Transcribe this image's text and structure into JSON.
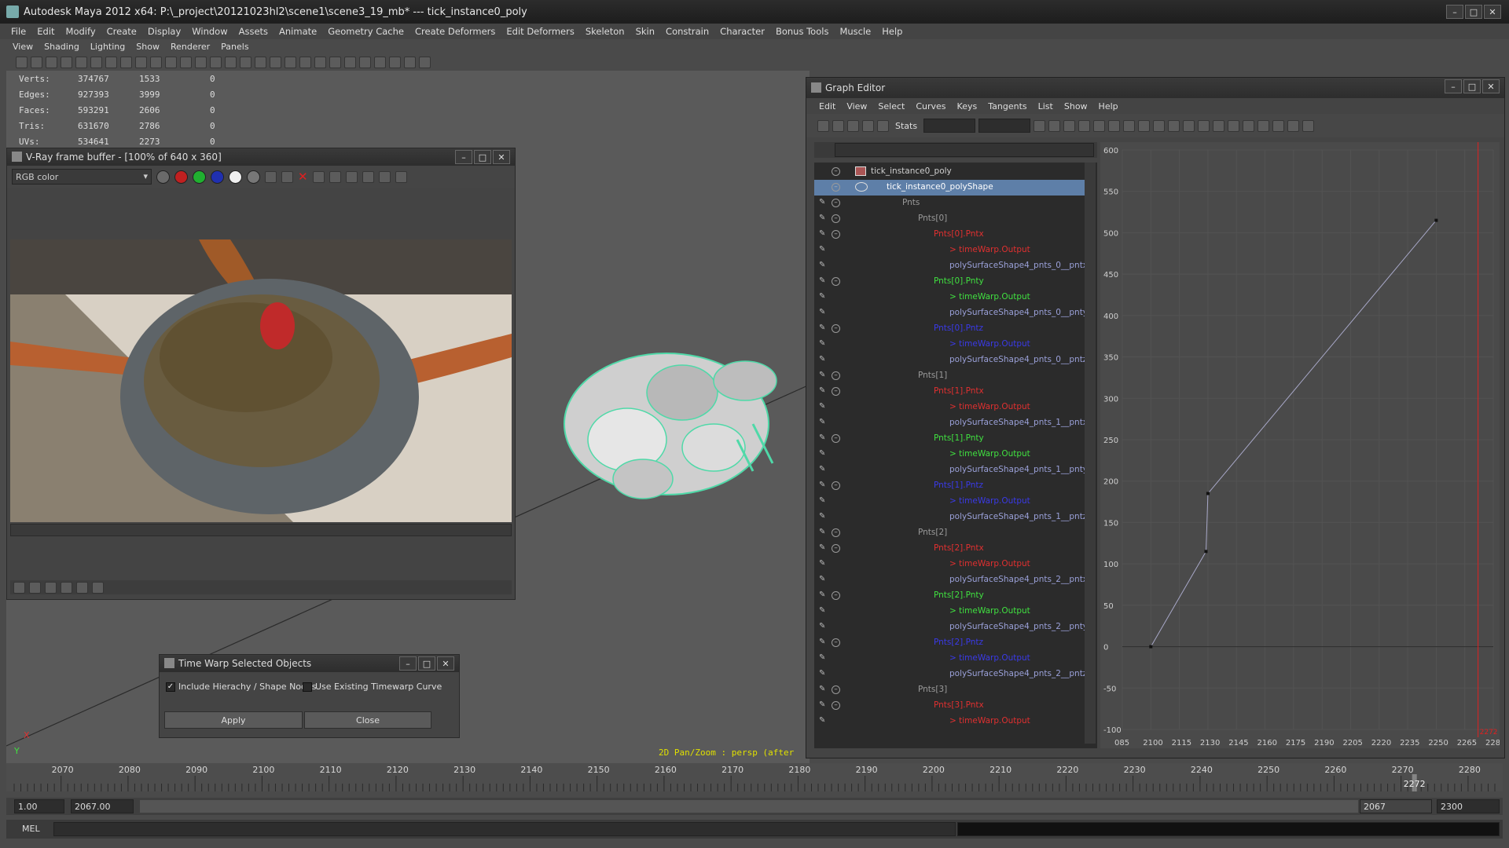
{
  "app": {
    "title": "Autodesk Maya 2012 x64: P:\\_project\\20121023hl2\\scene1\\scene3_19_mb*  ---  tick_instance0_poly"
  },
  "main_menu": [
    "File",
    "Edit",
    "Modify",
    "Create",
    "Display",
    "Window",
    "Assets",
    "Animate",
    "Geometry Cache",
    "Create Deformers",
    "Edit Deformers",
    "Skeleton",
    "Skin",
    "Constrain",
    "Character",
    "Bonus Tools",
    "Muscle",
    "Help"
  ],
  "panel_menu": [
    "View",
    "Shading",
    "Lighting",
    "Show",
    "Renderer",
    "Panels"
  ],
  "hud": [
    {
      "label": "Verts:",
      "a": "374767",
      "b": "1533",
      "c": "0"
    },
    {
      "label": "Edges:",
      "a": "927393",
      "b": "3999",
      "c": "0"
    },
    {
      "label": "Faces:",
      "a": "593291",
      "b": "2606",
      "c": "0"
    },
    {
      "label": "Tris:",
      "a": "631670",
      "b": "2786",
      "c": "0"
    },
    {
      "label": "UVs:",
      "a": "534641",
      "b": "2273",
      "c": "0"
    }
  ],
  "viewport_status": "2D Pan/Zoom : persp (after",
  "vray": {
    "title": "V-Ray frame buffer - [100% of 640 x 360]",
    "channel": "RGB color"
  },
  "timewarp": {
    "title": "Time Warp Selected Objects",
    "opt1": "Include Hierachy / Shape Nodes",
    "opt2": "Use Existing Timewarp Curve",
    "apply": "Apply",
    "close": "Close"
  },
  "graph_editor": {
    "title": "Graph Editor",
    "menu": [
      "Edit",
      "View",
      "Select",
      "Curves",
      "Keys",
      "Tangents",
      "List",
      "Show",
      "Help"
    ],
    "stats_label": "Stats",
    "outliner": [
      {
        "text": "tick_instance0_poly",
        "indent": 72,
        "color": "#cfcfcf",
        "exp": true,
        "pin": false,
        "sel": false
      },
      {
        "text": "tick_instance0_polyShape",
        "indent": 92,
        "color": "#ffffff",
        "exp": true,
        "pin": false,
        "sel": true
      },
      {
        "text": "Pnts",
        "indent": 112,
        "color": "#9a9a9a",
        "exp": true,
        "pin": true,
        "sel": false
      },
      {
        "text": "Pnts[0]",
        "indent": 132,
        "color": "#9a9a9a",
        "exp": true,
        "pin": true,
        "sel": false
      },
      {
        "text": "Pnts[0].Pntx",
        "indent": 152,
        "color": "#e03030",
        "exp": true,
        "pin": true,
        "sel": false
      },
      {
        "text": "> timeWarp.Output",
        "indent": 172,
        "color": "#e03030",
        "exp": false,
        "pin": true,
        "sel": false
      },
      {
        "text": "polySurfaceShape4_pnts_0__pntx",
        "indent": 172,
        "color": "#9aa0d8",
        "exp": false,
        "pin": true,
        "sel": false
      },
      {
        "text": "Pnts[0].Pnty",
        "indent": 152,
        "color": "#40e040",
        "exp": true,
        "pin": true,
        "sel": false
      },
      {
        "text": "> timeWarp.Output",
        "indent": 172,
        "color": "#40e040",
        "exp": false,
        "pin": true,
        "sel": false
      },
      {
        "text": "polySurfaceShape4_pnts_0__pnty",
        "indent": 172,
        "color": "#9aa0d8",
        "exp": false,
        "pin": true,
        "sel": false
      },
      {
        "text": "Pnts[0].Pntz",
        "indent": 152,
        "color": "#3a3ae8",
        "exp": true,
        "pin": true,
        "sel": false
      },
      {
        "text": "> timeWarp.Output",
        "indent": 172,
        "color": "#3a3ae8",
        "exp": false,
        "pin": true,
        "sel": false
      },
      {
        "text": "polySurfaceShape4_pnts_0__pntz",
        "indent": 172,
        "color": "#9aa0d8",
        "exp": false,
        "pin": true,
        "sel": false
      },
      {
        "text": "Pnts[1]",
        "indent": 132,
        "color": "#9a9a9a",
        "exp": true,
        "pin": true,
        "sel": false
      },
      {
        "text": "Pnts[1].Pntx",
        "indent": 152,
        "color": "#e03030",
        "exp": true,
        "pin": true,
        "sel": false
      },
      {
        "text": "> timeWarp.Output",
        "indent": 172,
        "color": "#e03030",
        "exp": false,
        "pin": true,
        "sel": false
      },
      {
        "text": "polySurfaceShape4_pnts_1__pntx",
        "indent": 172,
        "color": "#9aa0d8",
        "exp": false,
        "pin": true,
        "sel": false
      },
      {
        "text": "Pnts[1].Pnty",
        "indent": 152,
        "color": "#40e040",
        "exp": true,
        "pin": true,
        "sel": false
      },
      {
        "text": "> timeWarp.Output",
        "indent": 172,
        "color": "#40e040",
        "exp": false,
        "pin": true,
        "sel": false
      },
      {
        "text": "polySurfaceShape4_pnts_1__pnty",
        "indent": 172,
        "color": "#9aa0d8",
        "exp": false,
        "pin": true,
        "sel": false
      },
      {
        "text": "Pnts[1].Pntz",
        "indent": 152,
        "color": "#3a3ae8",
        "exp": true,
        "pin": true,
        "sel": false
      },
      {
        "text": "> timeWarp.Output",
        "indent": 172,
        "color": "#3a3ae8",
        "exp": false,
        "pin": true,
        "sel": false
      },
      {
        "text": "polySurfaceShape4_pnts_1__pntz",
        "indent": 172,
        "color": "#9aa0d8",
        "exp": false,
        "pin": true,
        "sel": false
      },
      {
        "text": "Pnts[2]",
        "indent": 132,
        "color": "#9a9a9a",
        "exp": true,
        "pin": true,
        "sel": false
      },
      {
        "text": "Pnts[2].Pntx",
        "indent": 152,
        "color": "#e03030",
        "exp": true,
        "pin": true,
        "sel": false
      },
      {
        "text": "> timeWarp.Output",
        "indent": 172,
        "color": "#e03030",
        "exp": false,
        "pin": true,
        "sel": false
      },
      {
        "text": "polySurfaceShape4_pnts_2__pntx",
        "indent": 172,
        "color": "#9aa0d8",
        "exp": false,
        "pin": true,
        "sel": false
      },
      {
        "text": "Pnts[2].Pnty",
        "indent": 152,
        "color": "#40e040",
        "exp": true,
        "pin": true,
        "sel": false
      },
      {
        "text": "> timeWarp.Output",
        "indent": 172,
        "color": "#40e040",
        "exp": false,
        "pin": true,
        "sel": false
      },
      {
        "text": "polySurfaceShape4_pnts_2__pnty",
        "indent": 172,
        "color": "#9aa0d8",
        "exp": false,
        "pin": true,
        "sel": false
      },
      {
        "text": "Pnts[2].Pntz",
        "indent": 152,
        "color": "#3a3ae8",
        "exp": true,
        "pin": true,
        "sel": false
      },
      {
        "text": "> timeWarp.Output",
        "indent": 172,
        "color": "#3a3ae8",
        "exp": false,
        "pin": true,
        "sel": false
      },
      {
        "text": "polySurfaceShape4_pnts_2__pntz",
        "indent": 172,
        "color": "#9aa0d8",
        "exp": false,
        "pin": true,
        "sel": false
      },
      {
        "text": "Pnts[3]",
        "indent": 132,
        "color": "#9a9a9a",
        "exp": true,
        "pin": true,
        "sel": false
      },
      {
        "text": "Pnts[3].Pntx",
        "indent": 152,
        "color": "#e03030",
        "exp": true,
        "pin": true,
        "sel": false
      },
      {
        "text": "> timeWarp.Output",
        "indent": 172,
        "color": "#e03030",
        "exp": false,
        "pin": true,
        "sel": false
      }
    ],
    "curve": {
      "y_ticks": [
        "600",
        "550",
        "500",
        "450",
        "400",
        "350",
        "300",
        "250",
        "200",
        "150",
        "100",
        "50",
        "0",
        "-50",
        "-100"
      ],
      "x_ticks": [
        "085",
        "2100",
        "2115",
        "2130",
        "2145",
        "2160",
        "2175",
        "2190",
        "2205",
        "2220",
        "2235",
        "2250",
        "2265",
        "2280"
      ],
      "keys": [
        [
          2100,
          0
        ],
        [
          2129,
          115
        ],
        [
          2130,
          185
        ],
        [
          2250,
          515
        ]
      ],
      "xlim": [
        2085,
        2280
      ],
      "ylim": [
        -100,
        600
      ],
      "current_frame": 2272,
      "current_frame_label": "2272",
      "colors": {
        "curve": "#a8a8c8",
        "current": "#e02020"
      }
    }
  },
  "timeline": {
    "ticks": [
      "2070",
      "2080",
      "2090",
      "2100",
      "2110",
      "2120",
      "2130",
      "2140",
      "2150",
      "2160",
      "2170",
      "2180",
      "2190",
      "2200",
      "2210",
      "2220",
      "2230",
      "2240",
      "2250",
      "2260",
      "2270",
      "2280"
    ],
    "start": 2063,
    "end": 2284,
    "current": "2272",
    "current_value": 2272
  },
  "range": {
    "start_field": "1.00",
    "range_start": "2067.00",
    "range_end_right": "2067",
    "end_field": "2300"
  },
  "cmd": {
    "label": "MEL"
  }
}
